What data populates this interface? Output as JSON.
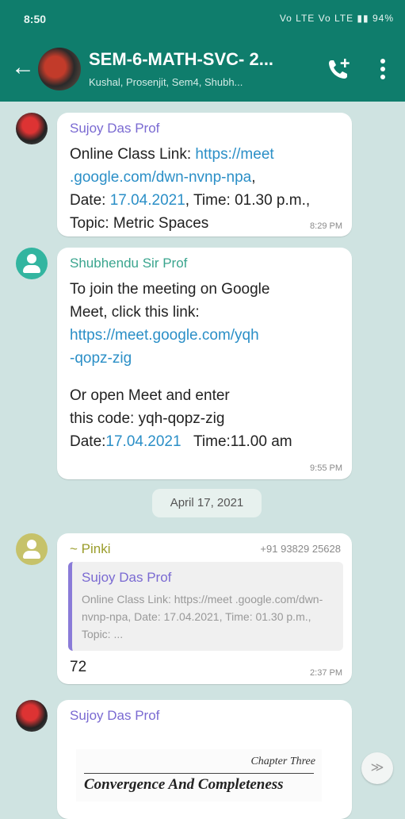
{
  "status_bar": {
    "time": "8:50",
    "indicators": "Vo LTE Vo LTE ▮▮ 94%",
    "battery": "94%"
  },
  "header": {
    "title": "SEM-6-MATH-SVC- 2...",
    "subtitle": "Kushal, Prosenjit, Sem4, Shubh...",
    "back_icon": "back-arrow-icon",
    "call_icon": "add-call-icon",
    "menu_icon": "more-vert-icon"
  },
  "messages": [
    {
      "sender": "Sujoy Das Prof",
      "line1_prefix": "Online Class Link: ",
      "line1_link": "https://meet",
      "line2_link": ".google.com/dwn-nvnp-npa",
      "line2_suffix": ",",
      "line3_prefix": "Date: ",
      "line3_date": "17.04.2021",
      "line3_suffix": ", Time: 01.30 p.m.,",
      "line4": "Topic: Metric Spaces",
      "time": "8:29 PM"
    },
    {
      "sender": "Shubhendu Sir Prof",
      "line1": "To join the meeting on Google",
      "line2": "Meet, click this link:",
      "line3_link": "https://meet.google.com/yqh",
      "line4_link": "-qopz-zig",
      "line5": "Or open Meet and enter",
      "line6": "this code: yqh-qopz-zig",
      "line7_prefix": "Date:",
      "line7_date": "17.04.2021",
      "line7_suffix": "   Time:11.00 am",
      "time": "9:55 PM"
    },
    {
      "sender": "~ Pinki",
      "phone": "+91 93829 25628",
      "quoted_sender": "Sujoy Das Prof",
      "quoted_text": "Online Class Link: https://meet .google.com/dwn-nvnp-npa, Date: 17.04.2021, Time: 01.30 p.m., Topic: ...",
      "text": "72",
      "time": "2:37 PM"
    },
    {
      "sender": "Sujoy Das Prof",
      "doc_chapter": "Chapter Three",
      "doc_title": "Convergence And Completeness"
    }
  ],
  "date_separator": "April 17, 2021",
  "scroll_down_icon": "double-chevron-down-icon",
  "colors": {
    "header": "#0f7d6c",
    "chat_bg": "#cfe3e1",
    "link": "#2b8fc7"
  }
}
